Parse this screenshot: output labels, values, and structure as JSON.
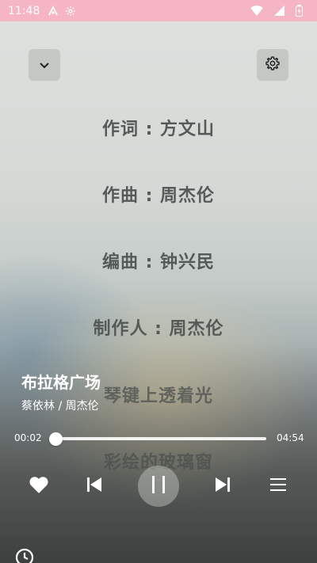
{
  "status_bar": {
    "time": "11:48",
    "icons": [
      "android-debug-icon",
      "gear-icon",
      "wifi-icon",
      "signal-icon",
      "battery-icon"
    ]
  },
  "header": {
    "collapse_icon": "chevron-down-icon",
    "settings_icon": "gear-icon"
  },
  "lyrics": [
    "作词 : 方文山",
    "作曲 : 周杰伦",
    "编曲 : 钟兴民",
    "制作人 : 周杰伦",
    "琴键上透着光",
    "彩绘的玻璃窗"
  ],
  "song": {
    "title": "布拉格广场",
    "artist": "蔡依林 / 周杰伦"
  },
  "progress": {
    "current": "00:02",
    "total": "04:54",
    "fraction": 0.007
  },
  "controls": {
    "like_icon": "heart-icon",
    "prev_icon": "skip-previous-icon",
    "pause_icon": "pause-icon",
    "next_icon": "skip-next-icon",
    "queue_icon": "queue-list-icon"
  },
  "bottom": {
    "timer_icon": "clock-icon"
  },
  "colors": {
    "status_bar": "#f5b5c5",
    "lyric_text": "#555a58",
    "control": "#ffffff"
  }
}
